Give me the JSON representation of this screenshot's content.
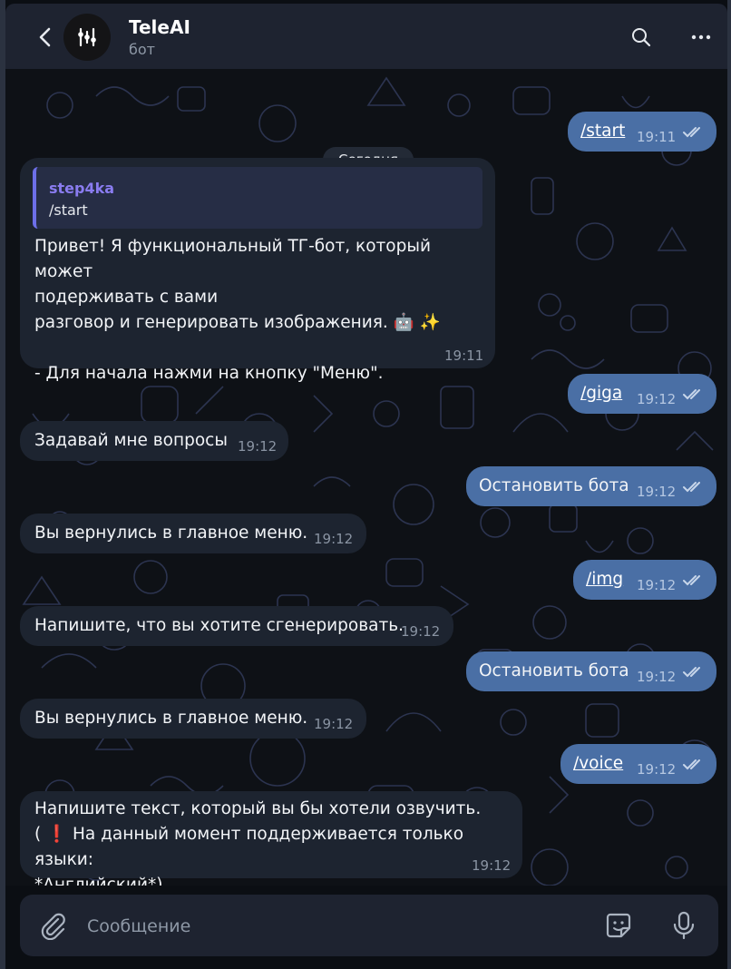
{
  "header": {
    "title": "TeleAI",
    "subtitle": "бот"
  },
  "chat": {
    "date_label": "Сегодня",
    "messages": [
      {
        "dir": "out",
        "text": "/start",
        "time": "19:11"
      },
      {
        "dir": "in",
        "reply_name": "step4ka",
        "reply_text": "/start",
        "lines": [
          "Привет! Я функциональный ТГ-бот, который может",
          "подерживать с вами",
          "разговор и генерировать изображения. 🤖 ✨",
          "",
          "- Для начала нажми на кнопку \"Меню\"."
        ],
        "time": "19:11"
      },
      {
        "dir": "out",
        "text": "/giga",
        "time": "19:12"
      },
      {
        "dir": "in",
        "text": "Задавай мне вопросы",
        "time": "19:12"
      },
      {
        "dir": "out",
        "text": "Остановить бота",
        "time": "19:12"
      },
      {
        "dir": "in",
        "text": "Вы вернулись в главное меню.",
        "time": "19:12"
      },
      {
        "dir": "out",
        "text": "/img",
        "time": "19:12"
      },
      {
        "dir": "in",
        "text": "Напишите, что вы хотите сгенерировать.",
        "time": "19:12"
      },
      {
        "dir": "out",
        "text": "Остановить бота",
        "time": "19:12"
      },
      {
        "dir": "in",
        "text": "Вы вернулись в главное меню.",
        "time": "19:12"
      },
      {
        "dir": "out",
        "text": "/voice",
        "time": "19:12"
      },
      {
        "dir": "in",
        "lines": [
          "Напишите текст, который вы бы хотели озвучить.",
          "( ❗ На данный момент поддерживается только языки:",
          "*Английский*)"
        ],
        "time": "19:12"
      }
    ]
  },
  "composer": {
    "placeholder": "Сообщение"
  },
  "icons": {
    "back": "chevron-left-icon",
    "avatar": "teleai-logo-icon",
    "search": "search-icon",
    "more": "more-dots-icon",
    "attach": "paperclip-icon",
    "sticker": "sticker-icon",
    "mic": "microphone-icon",
    "read": "double-check-icon"
  },
  "colors": {
    "background": "#0e1116",
    "header": "#1e2330",
    "incoming": "#1d2430",
    "outgoing": "#4a6fa5",
    "reply_accent": "#6d6fe8"
  }
}
